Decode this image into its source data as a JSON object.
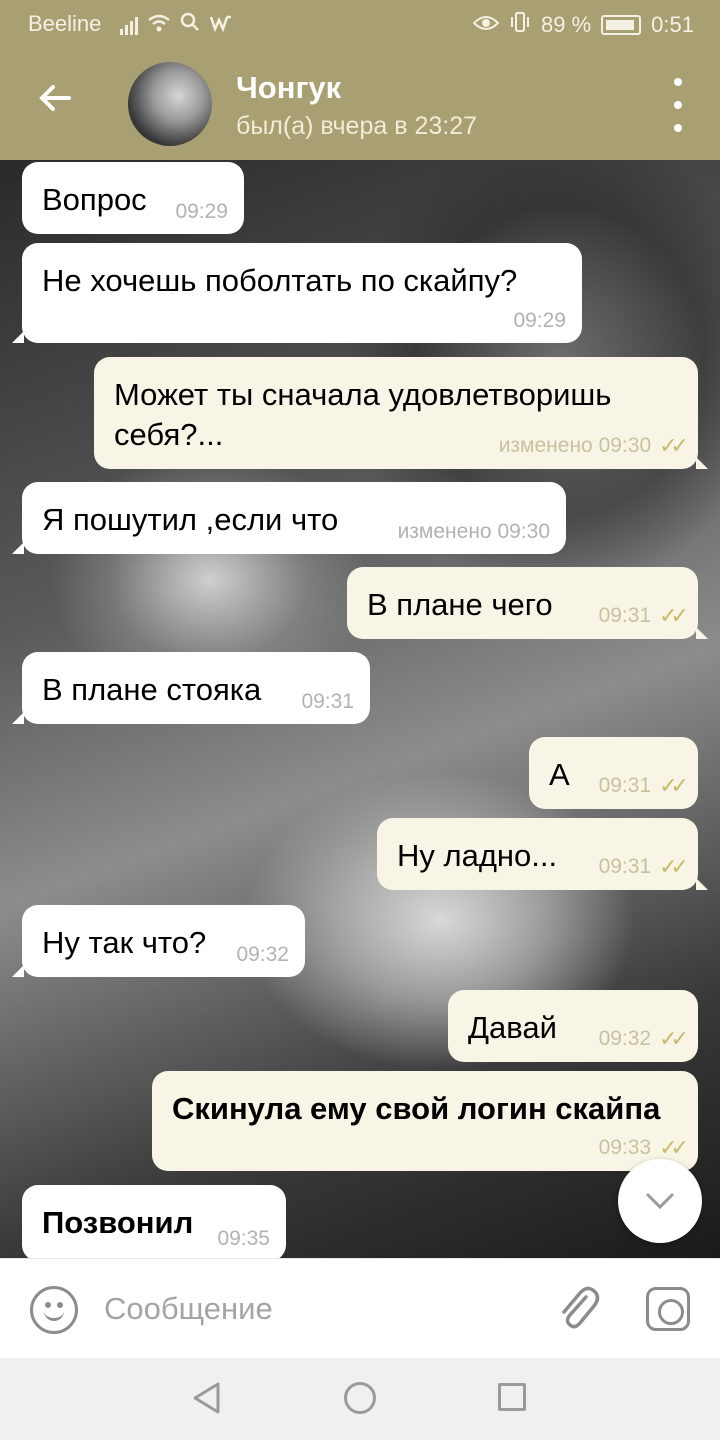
{
  "status_bar": {
    "carrier": "Beeline",
    "battery": "89 %",
    "time": "0:51"
  },
  "header": {
    "contact_name": "Чонгук",
    "last_seen": "был(а) вчера в 23:27"
  },
  "messages": [
    {
      "dir": "in",
      "text": "Вопрос",
      "time": "09:29",
      "edited": ""
    },
    {
      "dir": "in",
      "text": "Не хочешь поболтать по скайпу?",
      "time": "09:29",
      "edited": ""
    },
    {
      "dir": "out",
      "text_line1": "Может ты сначала удовлетворишь",
      "text_line2": "себя?...",
      "time": "изменено 09:30",
      "ticks": "✓✓"
    },
    {
      "dir": "in",
      "text": "Я пошутил ,если что",
      "time": "изменено 09:30"
    },
    {
      "dir": "out",
      "text": "В плане чего",
      "time": "09:31",
      "ticks": "✓✓"
    },
    {
      "dir": "in",
      "text": "В плане стояка",
      "time": "09:31"
    },
    {
      "dir": "out",
      "text": "А",
      "time": "09:31",
      "ticks": "✓✓"
    },
    {
      "dir": "out",
      "text": "Ну ладно...",
      "time": "09:31",
      "ticks": "✓✓"
    },
    {
      "dir": "in",
      "text": "Ну так что?",
      "time": "09:32"
    },
    {
      "dir": "out",
      "text": "Давай",
      "time": "09:32",
      "ticks": "✓✓"
    },
    {
      "dir": "out",
      "text": "Скинула ему свой логин скайпа",
      "time": "09:33",
      "ticks": "✓✓"
    },
    {
      "dir": "in",
      "text": "Позвонил",
      "time": "09:35"
    }
  ],
  "input": {
    "placeholder": "Сообщение"
  },
  "icons": {
    "back": "arrow-left-icon",
    "menu": "more-vertical-icon",
    "emoji": "smile-icon",
    "attach": "paperclip-icon",
    "camera": "camera-icon",
    "scroll_down": "chevron-down-icon"
  },
  "colors": {
    "header": "#a89f72",
    "incoming_bubble": "#ffffff",
    "outgoing_bubble": "#f8f5e6",
    "read_ticks": "#c9b96a"
  }
}
